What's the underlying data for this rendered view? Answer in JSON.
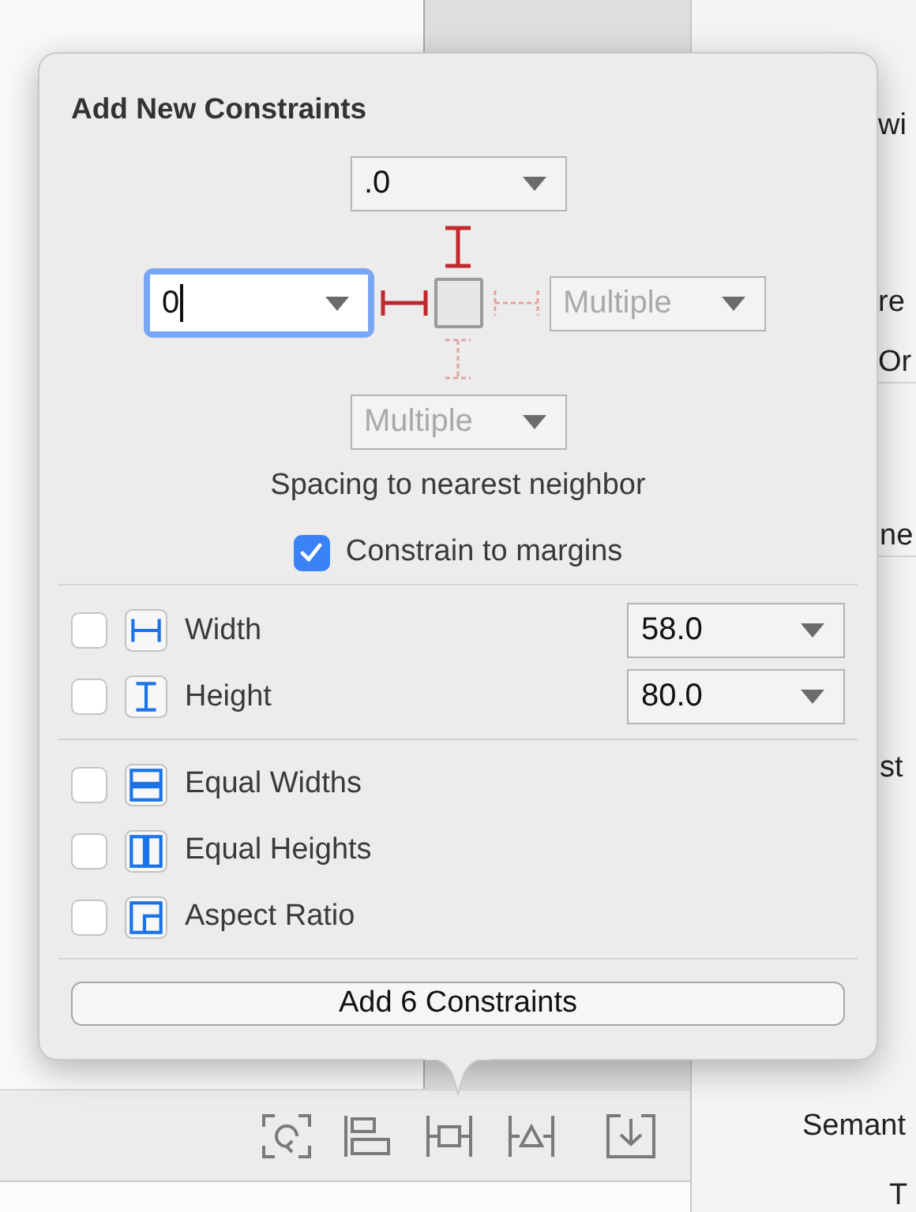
{
  "popover": {
    "title": "Add New Constraints",
    "spacing": {
      "top": {
        "value": ".0",
        "pinned": true
      },
      "left": {
        "value": "0",
        "pinned": true,
        "focused": true
      },
      "right": {
        "value": "Multiple",
        "pinned": false
      },
      "bottom": {
        "value": "Multiple",
        "pinned": false
      }
    },
    "spacing_caption": "Spacing to nearest neighbor",
    "constrain_to_margins": {
      "label": "Constrain to margins",
      "checked": true
    },
    "size_rows": [
      {
        "kind": "width",
        "label": "Width",
        "checked": false,
        "value": "58.0"
      },
      {
        "kind": "height",
        "label": "Height",
        "checked": false,
        "value": "80.0"
      }
    ],
    "equal_rows": [
      {
        "kind": "equal-widths",
        "label": "Equal Widths",
        "checked": false
      },
      {
        "kind": "equal-heights",
        "label": "Equal Heights",
        "checked": false
      },
      {
        "kind": "aspect-ratio",
        "label": "Aspect Ratio",
        "checked": false
      }
    ],
    "add_button": "Add 6 Constraints"
  },
  "inspector_labels": [
    "wi",
    "re",
    "Or",
    "ne",
    "st",
    "Semant",
    "T"
  ]
}
